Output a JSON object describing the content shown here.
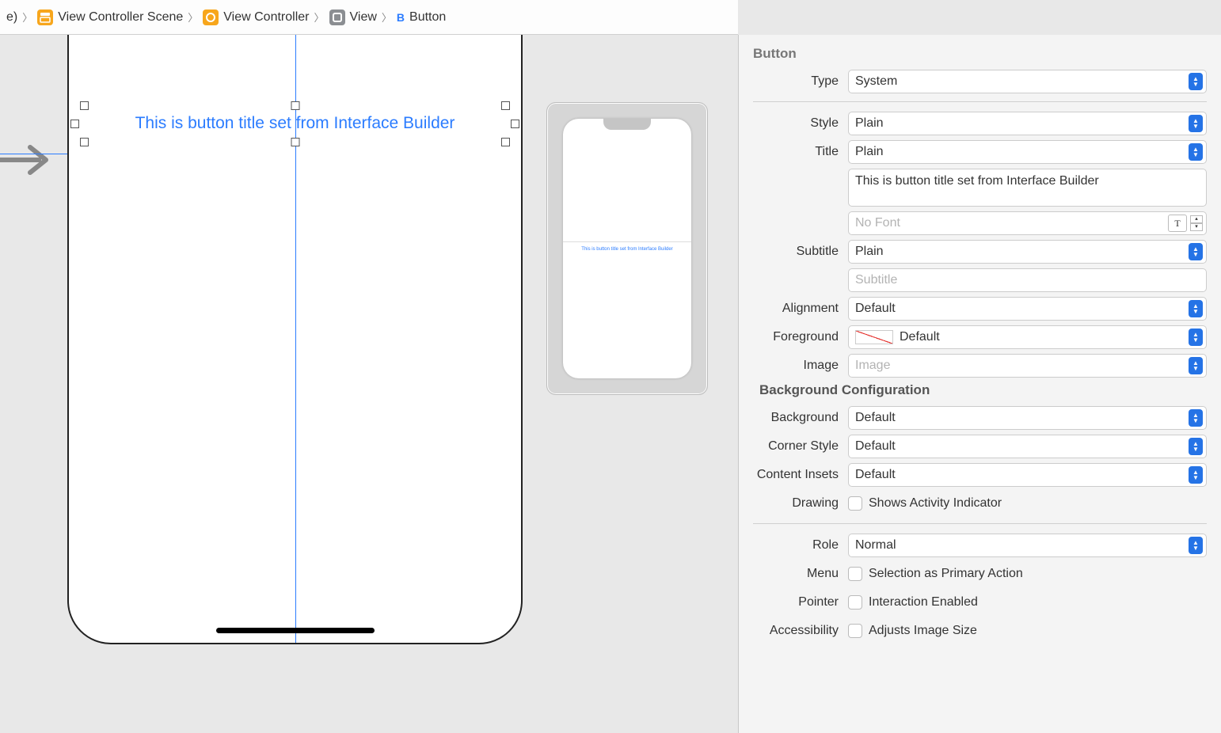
{
  "breadcrumb": {
    "root_suffix": "e)",
    "scene": "View Controller Scene",
    "vc": "View Controller",
    "view": "View",
    "button_icon": "B",
    "button": "Button"
  },
  "canvas": {
    "button_title": "This is button title set from Interface Builder",
    "thumb_text": "This is button title set from Interface Builder"
  },
  "inspector": {
    "header": "Button",
    "type_label": "Type",
    "type_value": "System",
    "style_label": "Style",
    "style_value": "Plain",
    "title_label": "Title",
    "title_value": "Plain",
    "title_text": "This is button title set from Interface Builder",
    "font_placeholder": "No Font",
    "subtitle_label": "Subtitle",
    "subtitle_value": "Plain",
    "subtitle_placeholder": "Subtitle",
    "alignment_label": "Alignment",
    "alignment_value": "Default",
    "foreground_label": "Foreground",
    "foreground_value": "Default",
    "image_label": "Image",
    "image_placeholder": "Image",
    "bg_section": "Background Configuration",
    "background_label": "Background",
    "background_value": "Default",
    "corner_label": "Corner Style",
    "corner_value": "Default",
    "insets_label": "Content Insets",
    "insets_value": "Default",
    "drawing_label": "Drawing",
    "drawing_check": "Shows Activity Indicator",
    "role_label": "Role",
    "role_value": "Normal",
    "menu_label": "Menu",
    "menu_check": "Selection as Primary Action",
    "pointer_label": "Pointer",
    "pointer_check": "Interaction Enabled",
    "accessibility_label": "Accessibility",
    "accessibility_check": "Adjusts Image Size"
  }
}
